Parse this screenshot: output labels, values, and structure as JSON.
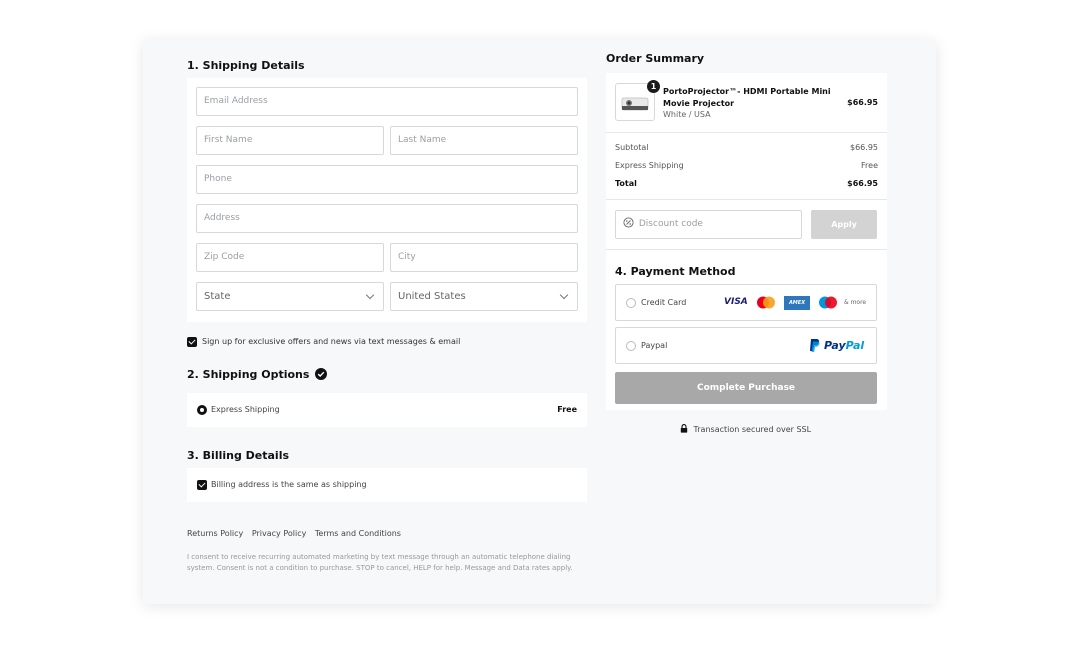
{
  "shipping": {
    "heading": "1. Shipping Details",
    "email_placeholder": "Email Address",
    "first_name_placeholder": "First Name",
    "last_name_placeholder": "Last Name",
    "phone_placeholder": "Phone",
    "address_placeholder": "Address",
    "zip_placeholder": "Zip Code",
    "city_placeholder": "City",
    "state_value": "State",
    "country_value": "United States",
    "signup_label": "Sign up for exclusive offers and news via text messages & email"
  },
  "shipping_options": {
    "heading": "2. Shipping Options",
    "option_label": "Express Shipping",
    "option_price": "Free"
  },
  "billing": {
    "heading": "3. Billing Details",
    "same_as_shipping_label": "Billing address is the same as shipping"
  },
  "footer": {
    "links": [
      "Returns Policy",
      "Privacy Policy",
      "Terms and Conditions"
    ],
    "consent": "I consent to receive recurring automated marketing by text message through an automatic telephone dialing system. Consent is not a condition to purchase. STOP to cancel, HELP for help. Message and Data rates apply."
  },
  "summary": {
    "heading": "Order Summary",
    "item": {
      "quantity": "1",
      "name": "PortoProjector™- HDMI Portable Mini Movie Projector",
      "variant": "White / USA",
      "price": "$66.95"
    },
    "subtotal_label": "Subtotal",
    "subtotal_value": "$66.95",
    "shipping_label": "Express Shipping",
    "shipping_value": "Free",
    "total_label": "Total",
    "total_value": "$66.95",
    "discount_placeholder": "Discount code",
    "apply_label": "Apply"
  },
  "payment": {
    "heading": "4. Payment Method",
    "credit_card_label": "Credit Card",
    "card_brands": [
      "VISA",
      "AMEX"
    ],
    "more_label": "& more",
    "paypal_label": "Paypal",
    "paypal_logo_text_1": "Pay",
    "paypal_logo_text_2": "Pal",
    "complete_label": "Complete Purchase",
    "ssl_label": "Transaction secured over SSL"
  },
  "colors": {
    "visa": "#1a1f71",
    "mastercard_red": "#eb001b",
    "mastercard_orange": "#f79e1b",
    "amex": "#2e77bc",
    "maestro_blue": "#0099df",
    "paypal_dark": "#003087",
    "paypal_light": "#009cde"
  }
}
